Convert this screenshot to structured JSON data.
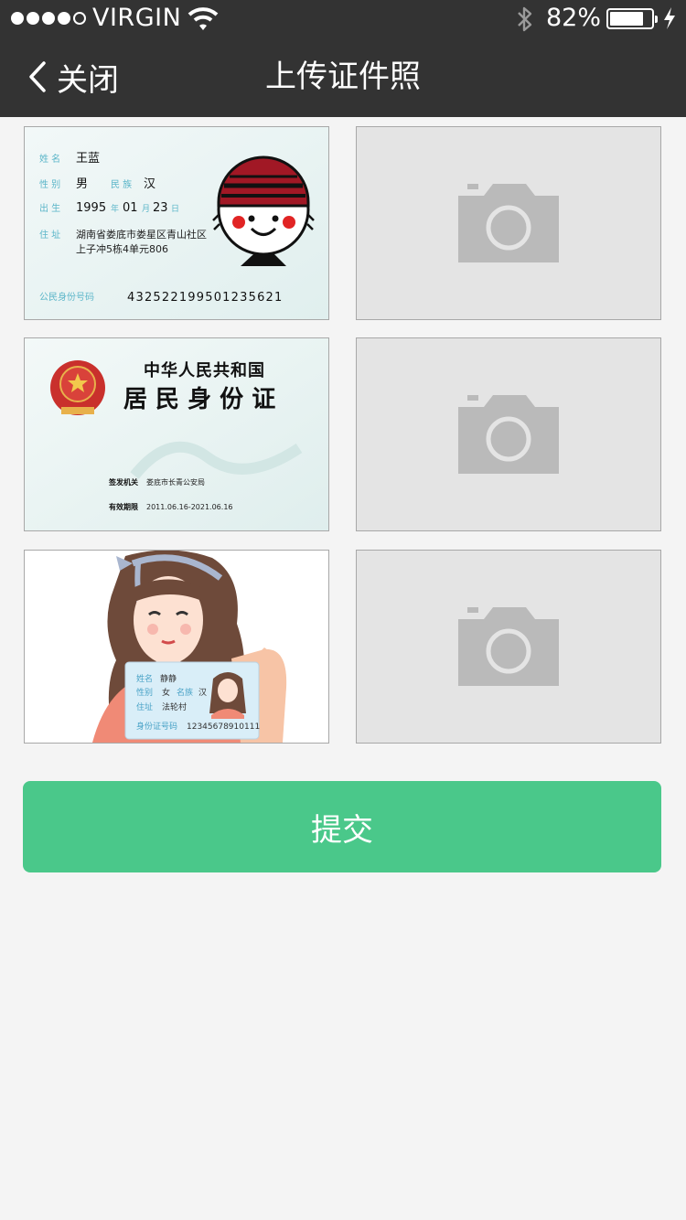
{
  "status_bar": {
    "carrier": "VIRGIN",
    "battery_percent": "82%",
    "battery_level": 0.82
  },
  "nav": {
    "back_label": "关闭",
    "title": "上传证件照"
  },
  "id_front": {
    "name_label": "姓 名",
    "name": "王蓝",
    "sex_label": "性 别",
    "sex": "男",
    "ethnicity_label": "民 族",
    "ethnicity": "汉",
    "birth_label": "出 生",
    "birth_year": "1995",
    "year_unit": "年",
    "birth_month": "01",
    "month_unit": "月",
    "birth_day": "23",
    "day_unit": "日",
    "address_label": "住 址",
    "address_line1": "湖南省娄底市娄星区青山社区",
    "address_line2": "上子冲5栋4单元806",
    "id_label": "公民身份号码",
    "id_number": "432522199501235621"
  },
  "id_back": {
    "country": "中华人民共和国",
    "card_name": "居 民 身 份 证",
    "authority_label": "签发机关",
    "authority": "娄底市长青公安局",
    "validity_label": "有效期限",
    "validity": "2011.06.16-2021.06.16"
  },
  "holding_card": {
    "name_label": "姓名",
    "name": "静静",
    "sex_label": "性别",
    "sex": "女",
    "ethnicity_label": "名族",
    "ethnicity": "汉",
    "address_label": "住址",
    "address": "法轮村",
    "id_label": "身份证号码",
    "id_number": "12345678910111"
  },
  "upload_slots": [
    {
      "icon": "camera-icon"
    },
    {
      "icon": "camera-icon"
    },
    {
      "icon": "camera-icon"
    }
  ],
  "submit_label": "提交",
  "colors": {
    "nav_bg": "#333333",
    "page_bg": "#f4f4f4",
    "submit_bg": "#4ac88a",
    "placeholder_bg": "#e4e4e4",
    "camera_icon": "#bababa"
  }
}
